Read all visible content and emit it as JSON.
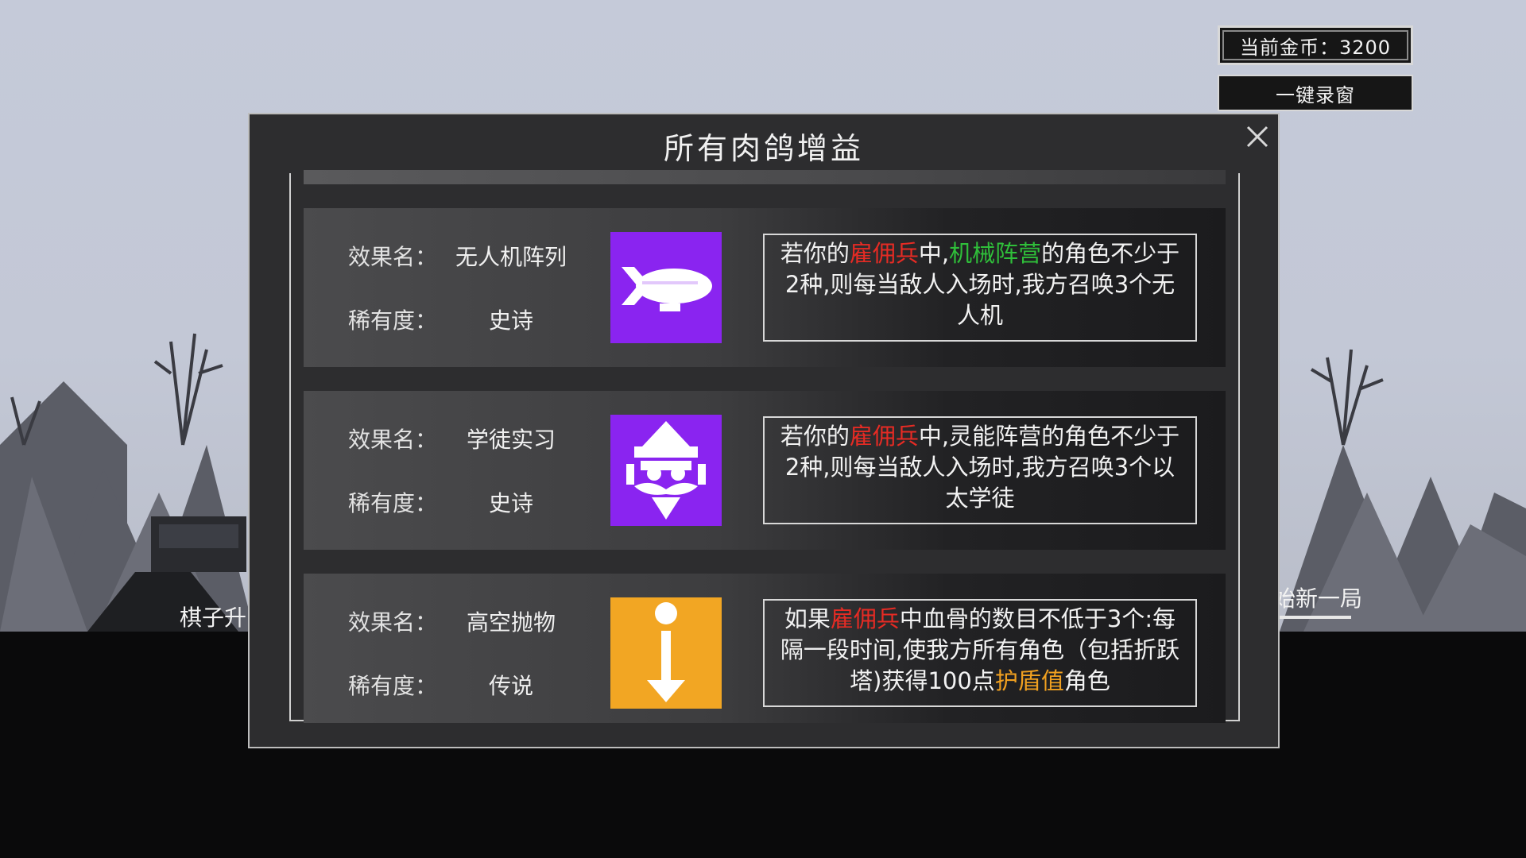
{
  "hud": {
    "gold": "当前金币：3200",
    "one_key": "一键录窗"
  },
  "background": {
    "left_label": "棋子升",
    "right_label": "始新一局"
  },
  "modal": {
    "title": "所有肉鸽增益",
    "effect_key": "效果名：",
    "rarity_key": "稀有度：",
    "items": [
      {
        "name": "无人机阵列",
        "rarity": "史诗",
        "icon": "airship-icon",
        "icon_bg": "#8a24f0",
        "desc": [
          {
            "t": "若你的"
          },
          {
            "t": "雇佣兵",
            "c": "red"
          },
          {
            "t": "中,"
          },
          {
            "t": "机械阵营",
            "c": "green"
          },
          {
            "t": "的角色不少于2种,则每当敌人入场时,我方召唤3个无人机"
          }
        ]
      },
      {
        "name": "学徒实习",
        "rarity": "史诗",
        "icon": "wizard-icon",
        "icon_bg": "#8a24f0",
        "desc": [
          {
            "t": "若你的"
          },
          {
            "t": "雇佣兵",
            "c": "red"
          },
          {
            "t": "中,灵能阵营的角色不少于2种,则每当敌人入场时,我方召唤3个以太学徒"
          }
        ]
      },
      {
        "name": "高空抛物",
        "rarity": "传说",
        "icon": "info-down-arrow-icon",
        "icon_bg": "#f2a623",
        "desc": [
          {
            "t": "如果"
          },
          {
            "t": "雇佣兵",
            "c": "red"
          },
          {
            "t": "中血骨的数目不低于3个:每隔一段时间,使我方所有角色（包括折跃塔)获得100点"
          },
          {
            "t": "护盾值",
            "c": "orange"
          },
          {
            "t": "角色"
          }
        ]
      }
    ]
  }
}
